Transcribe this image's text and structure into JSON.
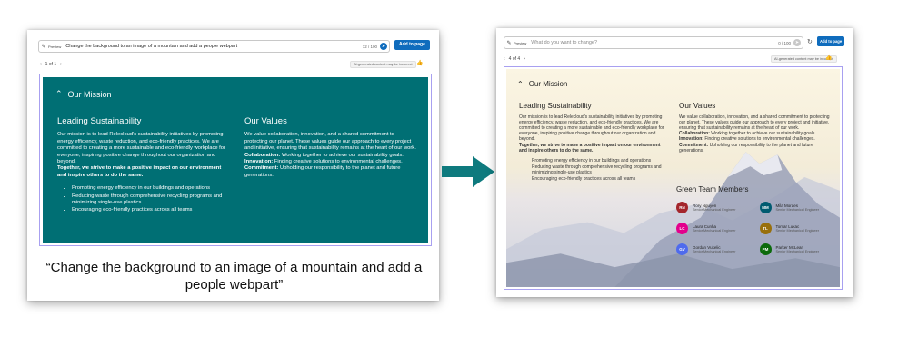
{
  "before": {
    "prompt_tag": "Preview",
    "prompt_text": "Change the background to an image of a mountain and add a people webpart",
    "char_count": "72 / 100",
    "add_button": "Add to page",
    "pager_text": "1 of 1",
    "ai_badge": "AI-generated content may be incorrect",
    "section_title": "Our Mission",
    "col1_title": "Leading Sustainability",
    "col1_para": "Our mission is to lead Relecloud's sustainability initiatives by promoting energy efficiency, waste reduction, and eco-friendly practices. We are committed to creating a more sustainable and eco-friendly workplace for everyone, inspiring positive change throughout our organization and beyond.",
    "col1_bold": "Together, we strive to make a positive impact on our environment and inspire others to do the same.",
    "bullets": [
      "Promoting energy efficiency in our buildings and operations",
      "Reducing waste through comprehensive recycling programs and minimizing single-use plastics",
      "Encouraging eco-friendly practices across all teams"
    ],
    "col2_title": "Our Values",
    "col2_para": "We value collaboration, innovation, and a shared commitment to protecting our planet. These values guide our approach to every project and initiative, ensuring that sustainability remains at the heart of our work.",
    "values": [
      {
        "label": "Collaboration:",
        "text": " Working together to achieve our sustainability goals."
      },
      {
        "label": "Innovation:",
        "text": " Finding creative solutions to environmental challenges."
      },
      {
        "label": "Commitment:",
        "text": " Upholding our responsibility to the planet and future generations."
      }
    ]
  },
  "after": {
    "prompt_tag": "Preview",
    "prompt_placeholder": "What do you want to change?",
    "char_count": "0 / 100",
    "add_button": "Add to page",
    "pager_text": "4 of 4",
    "ai_badge": "AI-generated content may be incorrect",
    "team_title": "Green Team Members",
    "people": [
      {
        "initials": "RN",
        "name": "Rory Nguyen",
        "role": "Senior Mechanical Engineer",
        "color": "#a4262c"
      },
      {
        "initials": "MM",
        "name": "Mila Moraes",
        "role": "Senior Mechanical Engineer",
        "color": "#005b70"
      },
      {
        "initials": "LC",
        "name": "Laura Cunha",
        "role": "Senior Mechanical Engineer",
        "color": "#e3008c"
      },
      {
        "initials": "TL",
        "name": "Tomar Lukac",
        "role": "Senior Mechanical Engineer",
        "color": "#986f0b"
      },
      {
        "initials": "GV",
        "name": "Gordan Vukelic",
        "role": "Senior Mechanical Engineer",
        "color": "#4f6bed"
      },
      {
        "initials": "PM",
        "name": "Parker McLean",
        "role": "Senior Mechanical Engineer",
        "color": "#0b6a0b"
      }
    ]
  },
  "caption": "“Change the background to an image of a mountain and add a people webpart”",
  "colors": {
    "teal": "#006f74",
    "accent": "#0f6cbd",
    "arrow": "#0e7a7e"
  }
}
